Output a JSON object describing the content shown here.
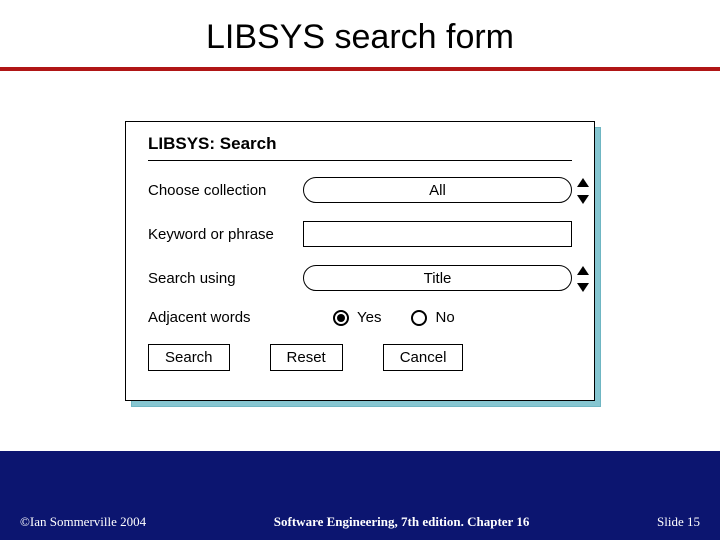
{
  "slide": {
    "title": "LIBSYS search form"
  },
  "form": {
    "heading": "LIBSYS: Search",
    "fields": {
      "collection": {
        "label": "Choose collection",
        "value": "All"
      },
      "keyword": {
        "label": "Keyword or phrase",
        "value": ""
      },
      "search_using": {
        "label": "Search using",
        "value": "Title"
      },
      "adjacent": {
        "label": "Adjacent words",
        "options": {
          "yes": "Yes",
          "no": "No"
        },
        "selected": "yes"
      }
    },
    "buttons": {
      "search": "Search",
      "reset": "Reset",
      "cancel": "Cancel"
    }
  },
  "footer": {
    "left": "©Ian Sommerville 2004",
    "center": "Software Engineering, 7th edition. Chapter 16",
    "right": "Slide 15"
  }
}
